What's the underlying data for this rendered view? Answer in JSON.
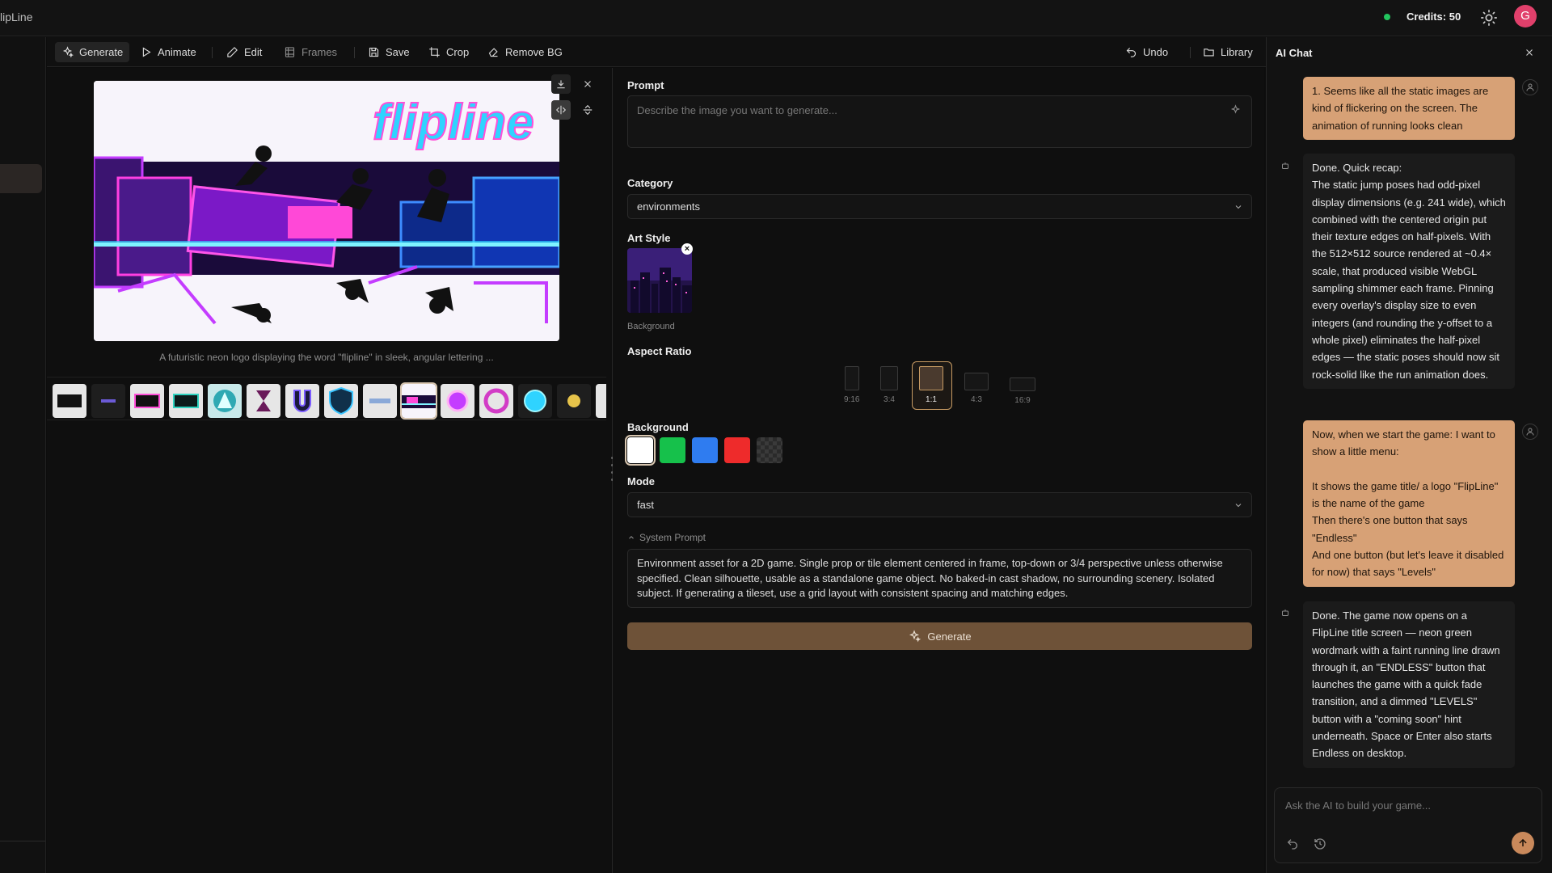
{
  "app": {
    "title": "lipLine",
    "credits": "Credits: 50",
    "avatar_letter": "G"
  },
  "toolbar": {
    "generate": "Generate",
    "animate": "Animate",
    "edit": "Edit",
    "frames": "Frames",
    "save": "Save",
    "crop": "Crop",
    "remove_bg": "Remove BG",
    "undo": "Undo",
    "library": "Library"
  },
  "preview": {
    "caption": "A futuristic neon logo displaying the word \"flipline\" in sleek, angular lettering ...",
    "logo_text": "flipline"
  },
  "form": {
    "prompt_label": "Prompt",
    "prompt_placeholder": "Describe the image you want to generate...",
    "category_label": "Category",
    "category_value": "environments",
    "art_style_label": "Art Style",
    "art_style_name": "Background",
    "aspect_label": "Aspect Ratio",
    "aspect_options": [
      "9:16",
      "3:4",
      "1:1",
      "4:3",
      "16:9"
    ],
    "aspect_selected": "1:1",
    "background_label": "Background",
    "background_colors": [
      "#ffffff",
      "#16c14b",
      "#2f7cf0",
      "#ee2b2b"
    ],
    "mode_label": "Mode",
    "mode_value": "fast",
    "system_prompt_label": "System Prompt",
    "system_prompt_text": "Environment asset for a 2D game. Single prop or tile element centered in frame, top-down or 3/4 perspective unless otherwise specified. Clean silhouette, usable as a standalone game object. No baked-in cast shadow, no surrounding scenery. Isolated subject. If generating a tileset, use a grid layout with consistent spacing and matching edges.",
    "generate_button": "Generate"
  },
  "chat": {
    "title": "AI Chat",
    "messages": [
      {
        "role": "user",
        "text": "1. Seems like all the static images are kind of flickering on the screen. The animation of running looks clean"
      },
      {
        "role": "ai",
        "text": "Done. Quick recap:\nThe static jump poses had odd-pixel display dimensions (e.g. 241 wide), which combined with the centered origin put their texture edges on half-pixels. With the 512×512 source rendered at ~0.4× scale, that produced visible WebGL sampling shimmer each frame. Pinning every overlay's display size to even integers (and rounding the y-offset to a whole pixel) eliminates the half-pixel edges — the static poses should now sit rock-solid like the run animation does."
      },
      {
        "role": "user",
        "text": "Now, when we start the game: I want to show a little menu:\n\nIt shows the game title/ a logo \"FlipLine\" is the name of the game\nThen there's one button that says \"Endless\"\nAnd one button (but let's leave it disabled for now) that says \"Levels\""
      },
      {
        "role": "ai",
        "text": "Done. The game now opens on a FlipLine title screen — neon green wordmark with a faint running line drawn through it, an \"ENDLESS\" button that launches the game with a quick fade transition, and a dimmed \"LEVELS\" button with a \"coming soon\" hint underneath. Space or Enter also starts Endless on desktop."
      }
    ],
    "input_placeholder": "Ask the AI to build your game..."
  },
  "colors": {
    "accent": "#d7a176",
    "generate_btn": "#6e5238",
    "send_btn": "#c9895b",
    "status": "#22c55e"
  }
}
